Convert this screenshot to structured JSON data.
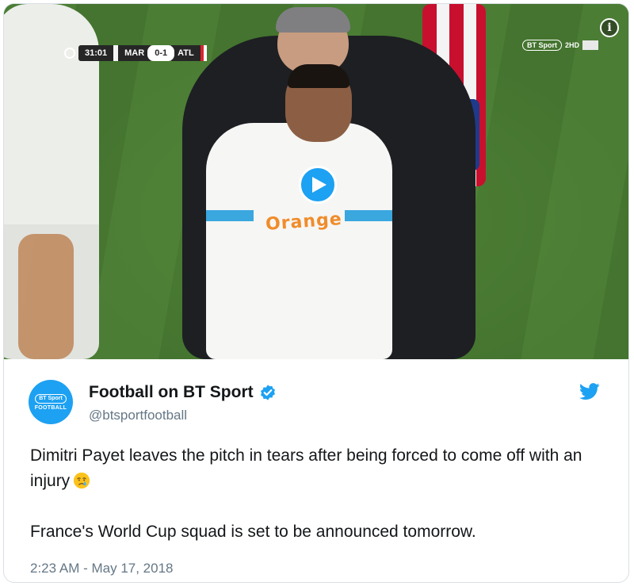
{
  "video": {
    "scoreboard": {
      "time": "31:01",
      "home_team": "MAR",
      "score": "0-1",
      "away_team": "ATL"
    },
    "broadcaster": {
      "logo_text": "BT Sport",
      "channel": "2HD"
    },
    "sponsor_text": "Orange",
    "icons": {
      "play": "play-icon",
      "info": "info-icon"
    },
    "info_glyph": "i"
  },
  "tweet": {
    "author": {
      "name": "Football on BT Sport",
      "handle": "@btsportfootball",
      "verified": true,
      "avatar_line1": "BT Sport",
      "avatar_line2": "FOOTBALL"
    },
    "text_line1": "Dimitri Payet leaves the pitch in tears after being forced to come off with an injury",
    "text_line1_emoji": "crying-face-emoji",
    "text_line2": "France's World Cup squad is set to be announced tomorrow.",
    "timestamp": "2:23 AM - May 17, 2018"
  },
  "colors": {
    "twitter_blue": "#1da1f2",
    "text_primary": "#14171a",
    "text_secondary": "#657786",
    "pitch_green": "#4b7d35"
  }
}
